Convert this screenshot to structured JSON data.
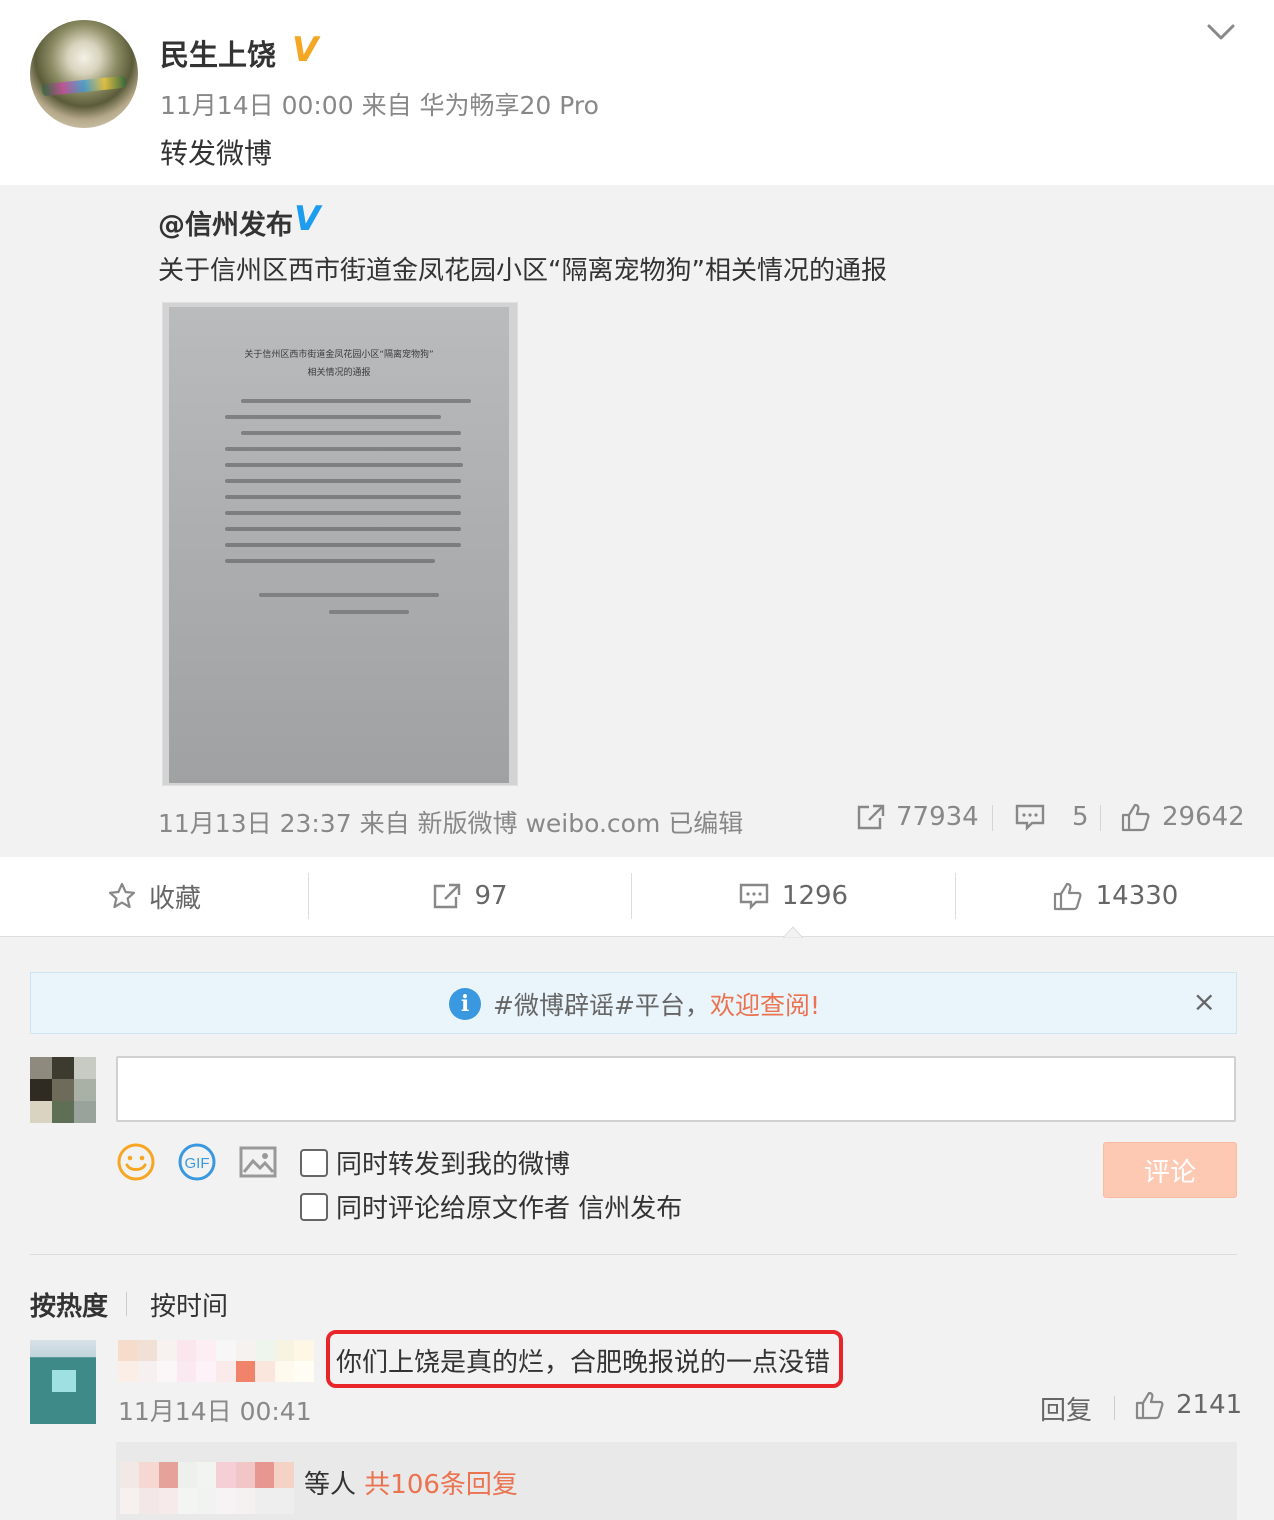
{
  "post": {
    "user_name": "民生上饶",
    "verified_badge": "V",
    "meta": "11月14日 00:00 来自 华为畅享20 Pro",
    "text": "转发微博"
  },
  "original": {
    "user": "@信州发布",
    "verified_badge": "V",
    "text": "关于信州区西市街道金凤花园小区“隔离宠物狗”相关情况的通报",
    "document": {
      "title": "关于信州区西市街道金凤花园小区“隔离宠物狗”",
      "subtitle": "相关情况的通报"
    },
    "meta": "11月13日 23:37 来自 新版微博 weibo.com  已编辑",
    "reposts": "77934",
    "comments": "5",
    "likes": "29642"
  },
  "actions": {
    "favorite": "收藏",
    "repost": "97",
    "comment": "1296",
    "like": "14330"
  },
  "notice": {
    "text": "#微博辟谣#平台，",
    "link": "欢迎查阅!",
    "close": "×"
  },
  "composer": {
    "input_value": "",
    "repost_option": "同时转发到我的微博",
    "comment_option": "同时评论给原文作者 信州发布",
    "submit": "评论"
  },
  "sort": {
    "hot": "按热度",
    "time": "按时间"
  },
  "comment": {
    "text": "你们上饶是真的烂，合肥晚报说的一点没错",
    "time": "11月14日 00:41",
    "reply": "回复",
    "likes": "2141",
    "replies_suffix": "等人",
    "replies_count": "共106条回复"
  },
  "colors": {
    "accent_orange": "#eb7350",
    "verified_gold": "#f5a623",
    "verified_blue": "#1e9cf0",
    "highlight_red": "#e8262a"
  }
}
